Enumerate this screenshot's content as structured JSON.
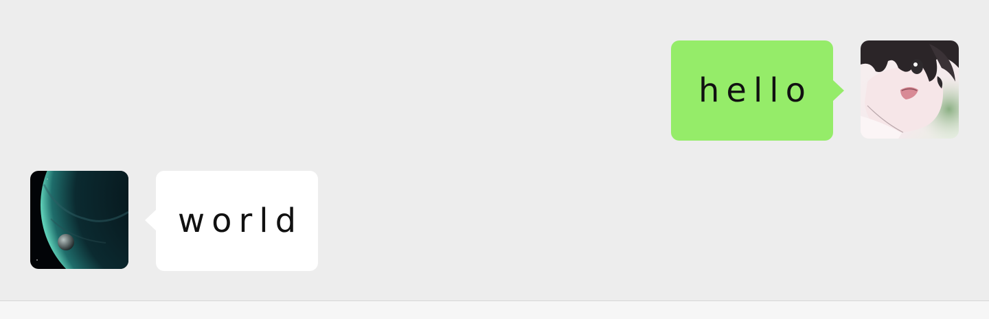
{
  "colors": {
    "background": "#ededed",
    "outgoing_bubble": "#95ec69",
    "incoming_bubble": "#ffffff",
    "text": "#111111"
  },
  "messages": [
    {
      "direction": "outgoing",
      "text": "hello",
      "avatar_icon": "anime-boy-avatar-icon"
    },
    {
      "direction": "incoming",
      "text": "world",
      "avatar_icon": "planet-avatar-icon"
    }
  ]
}
